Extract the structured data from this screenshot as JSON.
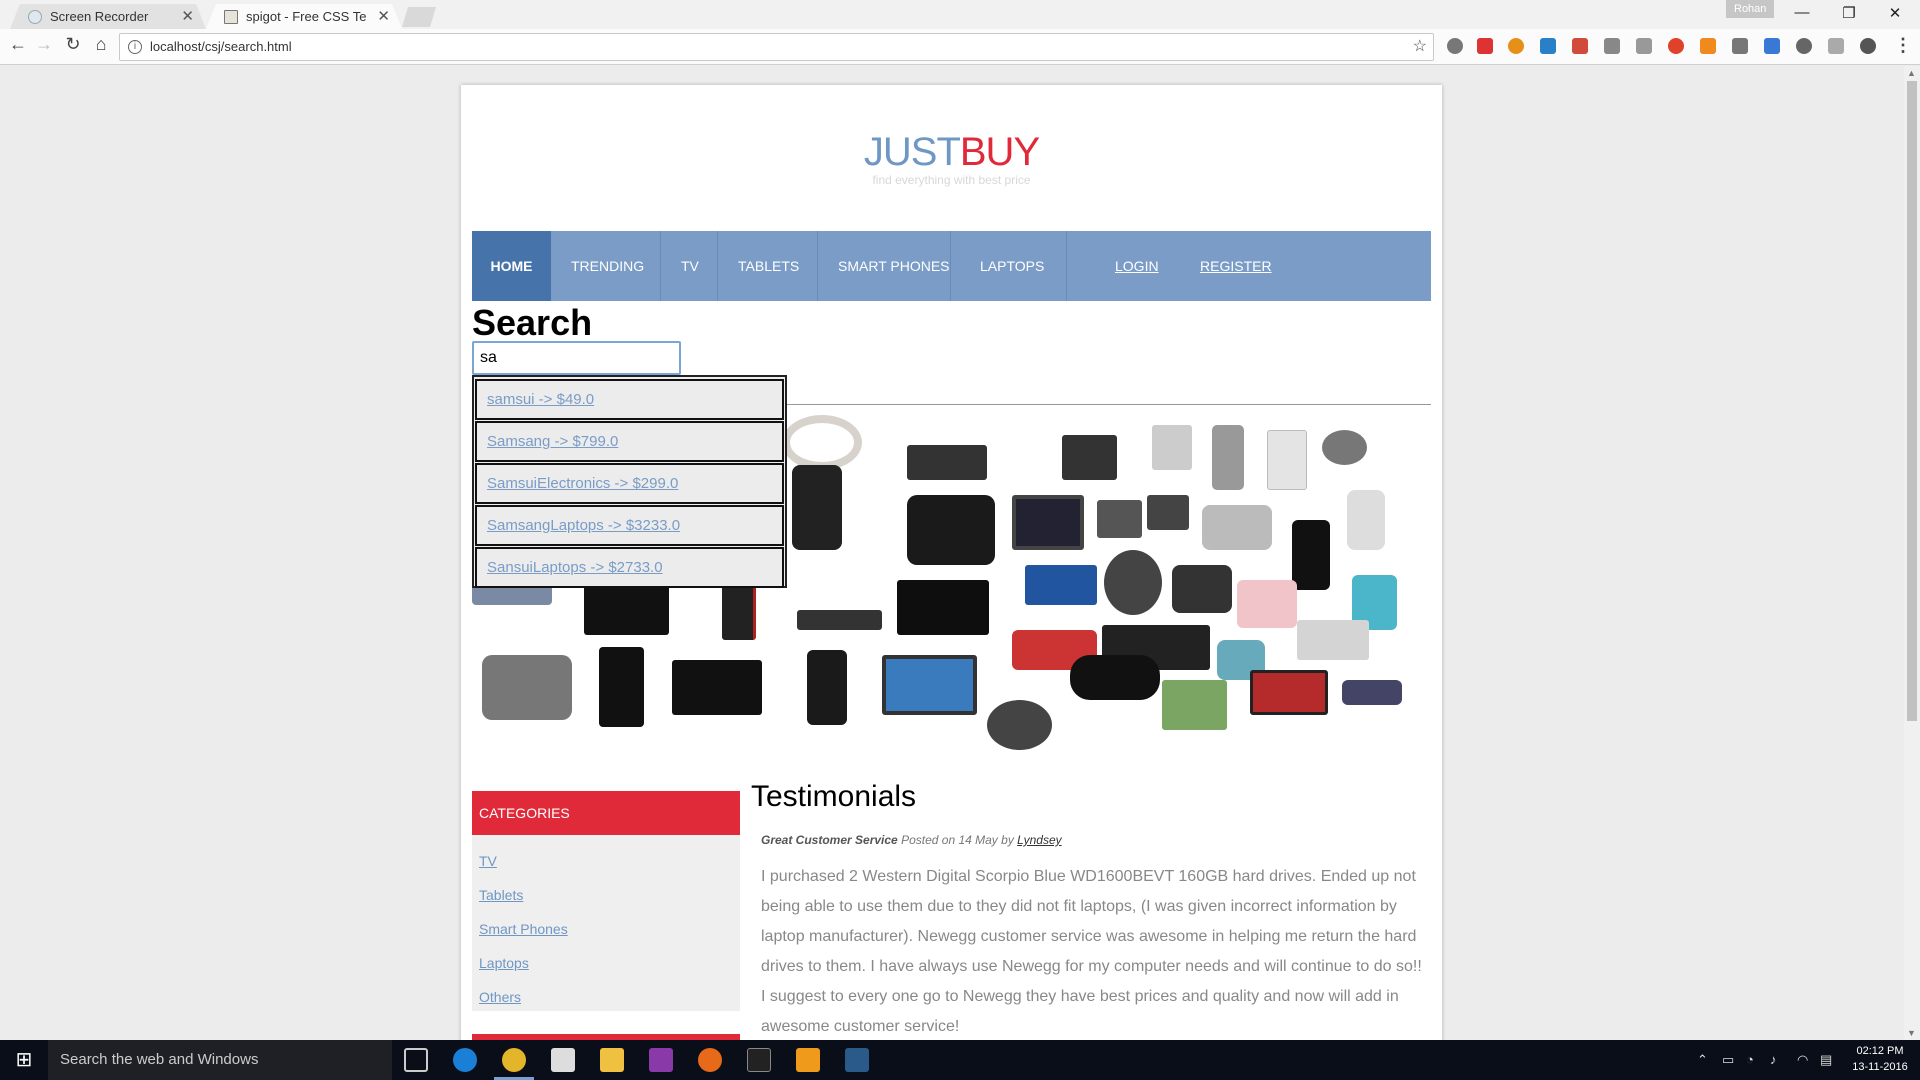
{
  "browser": {
    "tabs": [
      {
        "title": "Screen Recorder"
      },
      {
        "title": "spigot - Free CSS Templa"
      }
    ],
    "profile_name": "Rohan",
    "url": "localhost/csj/search.html"
  },
  "site": {
    "logo_part1": "JUST",
    "logo_part2": "BUY",
    "tagline": "find everything with best price",
    "nav": [
      "HOME",
      "TRENDING",
      "TV",
      "TABLETS",
      "SMART PHONES",
      "LAPTOPS"
    ],
    "login": "LOGIN",
    "register": "REGISTER",
    "search_title": "Search",
    "search_value": "sa",
    "suggestions": [
      "samsui -> $49.0",
      "Samsang -> $799.0",
      "SamsuiElectronics -> $299.0",
      "SamsangLaptops -> $3233.0",
      "SansuiLaptops -> $2733.0"
    ],
    "categories_title": "CATEGORIES",
    "categories": [
      "TV",
      "Tablets",
      "Smart Phones",
      "Laptops",
      "Others"
    ],
    "testimonials_title": "Testimonials",
    "testimonial": {
      "subject": "Great Customer Service",
      "posted": "Posted on 14 May by",
      "author": "Lyndsey",
      "body": "I purchased 2 Western Digital Scorpio Blue WD1600BEVT 160GB hard drives. Ended up not being able to use them due to they did not fit laptops, (I was given incorrect information by laptop manufacturer). Newegg customer service was awesome in helping me return the hard drives to them. I have always use Newegg for my computer needs and will continue to do so!! I suggest to every one go to Newegg they have best prices and quality and now will add in awesome customer service!"
    }
  },
  "taskbar": {
    "search_placeholder": "Search the web and Windows",
    "time": "02:12 PM",
    "date": "13-11-2016"
  },
  "colors": {
    "nav_bg": "#7a9cc6",
    "nav_active": "#4673aa",
    "accent_red": "#e02a3a",
    "logo_blue": "#6f97c3"
  }
}
